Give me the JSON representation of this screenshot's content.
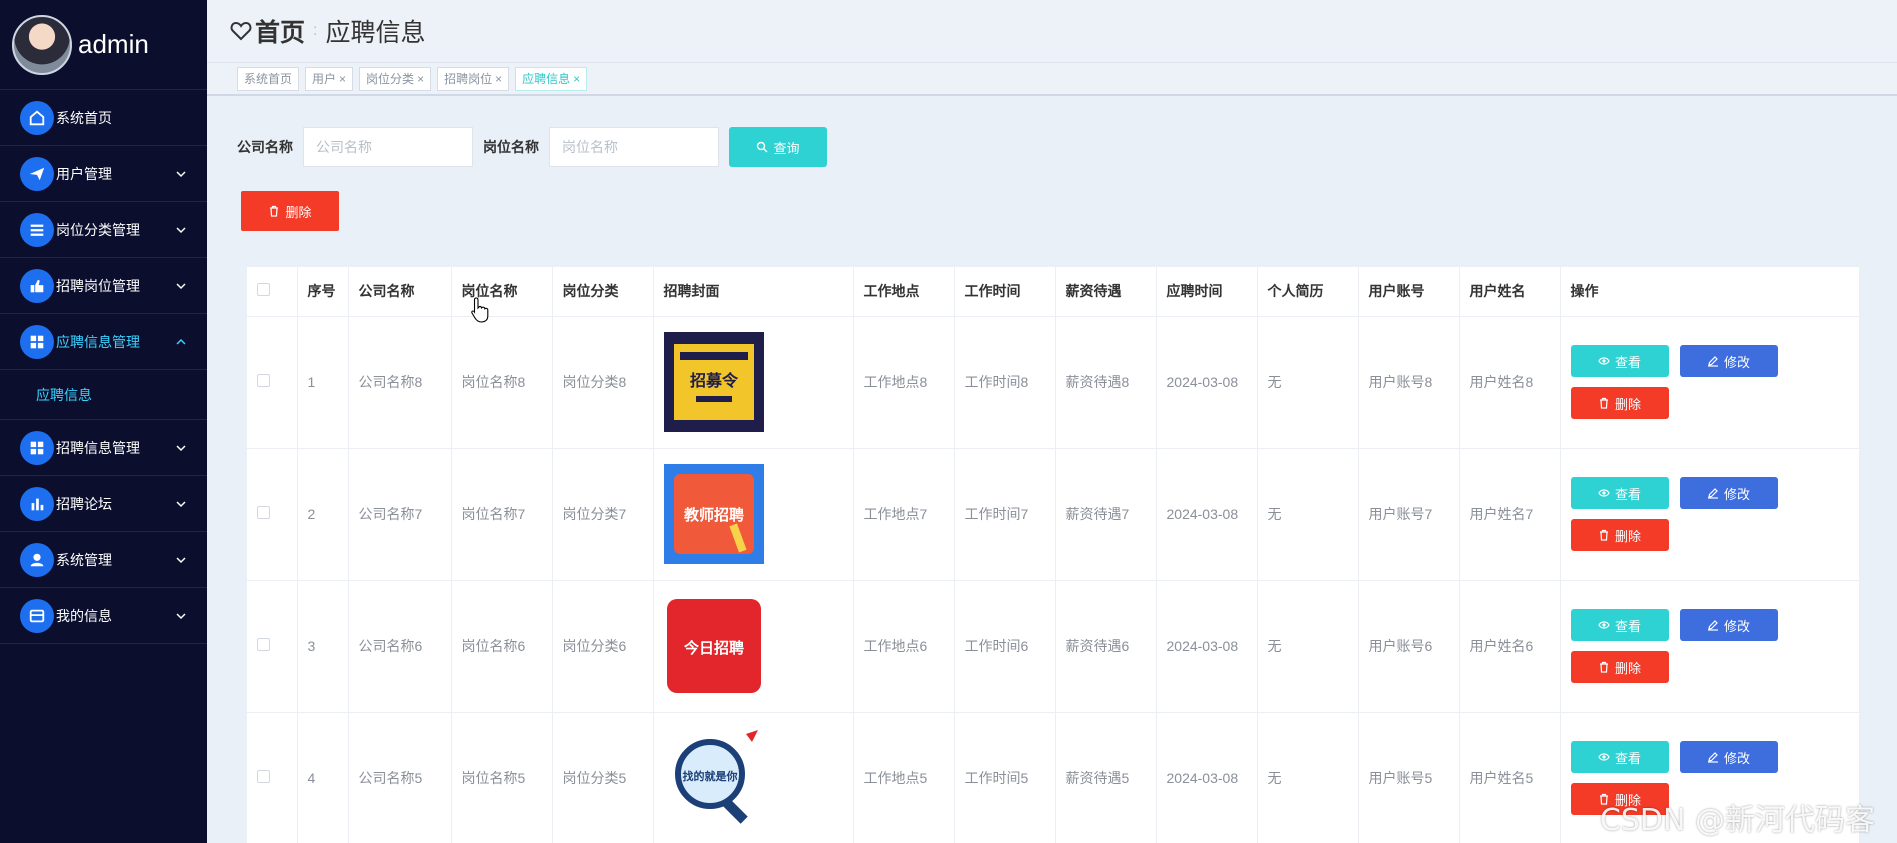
{
  "sidebar": {
    "username": "admin",
    "items": [
      {
        "label": "系统首页",
        "icon": "home-icon",
        "has_children": false
      },
      {
        "label": "用户管理",
        "icon": "paper-plane-icon",
        "has_children": true
      },
      {
        "label": "岗位分类管理",
        "icon": "list-icon",
        "has_children": true
      },
      {
        "label": "招聘岗位管理",
        "icon": "thumbs-up-icon",
        "has_children": true
      },
      {
        "label": "应聘信息管理",
        "icon": "grid-icon",
        "has_children": true,
        "expanded": true
      },
      {
        "label": "招聘信息管理",
        "icon": "grid-icon",
        "has_children": true
      },
      {
        "label": "招聘论坛",
        "icon": "bar-chart-icon",
        "has_children": true
      },
      {
        "label": "系统管理",
        "icon": "user-icon",
        "has_children": true
      },
      {
        "label": "我的信息",
        "icon": "card-icon",
        "has_children": true
      }
    ],
    "submenu": {
      "label": "应聘信息"
    }
  },
  "header": {
    "home": "首页",
    "title": "应聘信息"
  },
  "tags": [
    {
      "label": "系统首页",
      "closable": false,
      "active": false
    },
    {
      "label": "用户",
      "closable": true,
      "active": false
    },
    {
      "label": "岗位分类",
      "closable": true,
      "active": false
    },
    {
      "label": "招聘岗位",
      "closable": true,
      "active": false
    },
    {
      "label": "应聘信息",
      "closable": true,
      "active": true
    }
  ],
  "search": {
    "company_label": "公司名称",
    "company_placeholder": "公司名称",
    "position_label": "岗位名称",
    "position_placeholder": "岗位名称",
    "query_button": "查询"
  },
  "toolbar": {
    "delete_button": "删除"
  },
  "table": {
    "columns": [
      "序号",
      "公司名称",
      "岗位名称",
      "岗位分类",
      "招聘封面",
      "工作地点",
      "工作时间",
      "薪资待遇",
      "应聘时间",
      "个人简历",
      "用户账号",
      "用户姓名",
      "操作"
    ],
    "view_label": "查看",
    "edit_label": "修改",
    "delete_label": "删除",
    "rows": [
      {
        "no": "1",
        "company": "公司名称8",
        "position": "岗位名称8",
        "category": "岗位分类8",
        "cover": "招募令",
        "location": "工作地点8",
        "worktime": "工作时间8",
        "salary": "薪资待遇8",
        "apply_time": "2024-03-08",
        "resume": "无",
        "account": "用户账号8",
        "name": "用户姓名8"
      },
      {
        "no": "2",
        "company": "公司名称7",
        "position": "岗位名称7",
        "category": "岗位分类7",
        "cover": "教师招聘",
        "location": "工作地点7",
        "worktime": "工作时间7",
        "salary": "薪资待遇7",
        "apply_time": "2024-03-08",
        "resume": "无",
        "account": "用户账号7",
        "name": "用户姓名7"
      },
      {
        "no": "3",
        "company": "公司名称6",
        "position": "岗位名称6",
        "category": "岗位分类6",
        "cover": "今日招聘",
        "location": "工作地点6",
        "worktime": "工作时间6",
        "salary": "薪资待遇6",
        "apply_time": "2024-03-08",
        "resume": "无",
        "account": "用户账号6",
        "name": "用户姓名6"
      },
      {
        "no": "4",
        "company": "公司名称5",
        "position": "岗位名称5",
        "category": "岗位分类5",
        "cover": "找的就是你",
        "location": "工作地点5",
        "worktime": "工作时间5",
        "salary": "薪资待遇5",
        "apply_time": "2024-03-08",
        "resume": "无",
        "account": "用户账号5",
        "name": "用户姓名5"
      }
    ]
  },
  "watermark": "CSDN @新河代码客",
  "colors": {
    "sidebar_bg": "#0b0f2d",
    "accent_cyan": "#2fd2d2",
    "edit_blue": "#3e6ddd",
    "danger_red": "#f33b27"
  }
}
